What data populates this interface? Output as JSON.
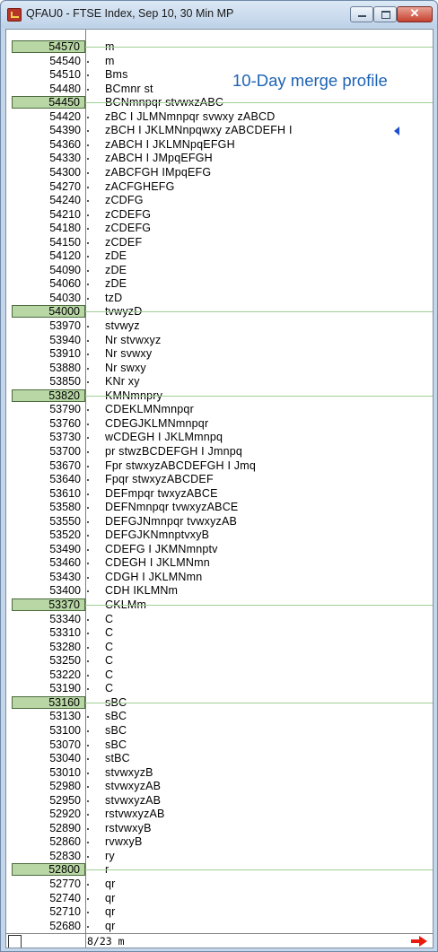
{
  "window": {
    "title": "QFAU0 - FTSE Index, Sep 10, 30 Min MP",
    "controls": {
      "minimize": "",
      "maximize": "",
      "close": "✕"
    }
  },
  "note": "10-Day merge profile",
  "rows": [
    {
      "price": "54570",
      "tpo": "m",
      "hl": true
    },
    {
      "price": "54540",
      "tpo": "m"
    },
    {
      "price": "54510",
      "tpo": "Bms"
    },
    {
      "price": "54480",
      "tpo": "BCmnr st"
    },
    {
      "price": "54450",
      "tpo": "BCNmnpqr stvwxzABC",
      "hl": true
    },
    {
      "price": "54420",
      "tpo": "zBC I JLMNmnpqr svwxy zABCD"
    },
    {
      "price": "54390",
      "tpo": "zBCH I JKLMNnpqwxy zABCDEFH I"
    },
    {
      "price": "54360",
      "tpo": "zABCH I JKLMNpqEFGH"
    },
    {
      "price": "54330",
      "tpo": "zABCH I JMpqEFGH"
    },
    {
      "price": "54300",
      "tpo": "zABCFGH IMpqEFG"
    },
    {
      "price": "54270",
      "tpo": "zACFGHEFG"
    },
    {
      "price": "54240",
      "tpo": "zCDFG"
    },
    {
      "price": "54210",
      "tpo": "zCDEFG"
    },
    {
      "price": "54180",
      "tpo": "zCDEFG"
    },
    {
      "price": "54150",
      "tpo": "zCDEF"
    },
    {
      "price": "54120",
      "tpo": "zDE"
    },
    {
      "price": "54090",
      "tpo": "zDE"
    },
    {
      "price": "54060",
      "tpo": "zDE"
    },
    {
      "price": "54030",
      "tpo": "tzD"
    },
    {
      "price": "54000",
      "tpo": "tvwyzD",
      "hl": true
    },
    {
      "price": "53970",
      "tpo": "stvwyz"
    },
    {
      "price": "53940",
      "tpo": "Nr stvwxyz"
    },
    {
      "price": "53910",
      "tpo": "Nr svwxy"
    },
    {
      "price": "53880",
      "tpo": "Nr swxy"
    },
    {
      "price": "53850",
      "tpo": "KNr xy"
    },
    {
      "price": "53820",
      "tpo": "KMNmnpry",
      "hl": true
    },
    {
      "price": "53790",
      "tpo": "CDEKLMNmnpqr"
    },
    {
      "price": "53760",
      "tpo": "CDEGJKLMNmnpqr"
    },
    {
      "price": "53730",
      "tpo": "wCDEGH I JKLMmnpq"
    },
    {
      "price": "53700",
      "tpo": "pr stwzBCDEFGH I Jmnpq"
    },
    {
      "price": "53670",
      "tpo": "Fpr stwxyzABCDEFGH I Jmq"
    },
    {
      "price": "53640",
      "tpo": "Fpqr stwxyzABCDEF"
    },
    {
      "price": "53610",
      "tpo": "DEFmpqr twxyzABCE"
    },
    {
      "price": "53580",
      "tpo": "DEFNmnpqr tvwxyzABCE"
    },
    {
      "price": "53550",
      "tpo": "DEFGJNmnpqr tvwxyzAB"
    },
    {
      "price": "53520",
      "tpo": "DEFGJKNmnptvxyB"
    },
    {
      "price": "53490",
      "tpo": "CDEFG I JKMNmnptv"
    },
    {
      "price": "53460",
      "tpo": "CDEGH I JKLMNmn"
    },
    {
      "price": "53430",
      "tpo": "CDGH I JKLMNmn"
    },
    {
      "price": "53400",
      "tpo": "CDH IKLMNm"
    },
    {
      "price": "53370",
      "tpo": "CKLMm",
      "hl": true
    },
    {
      "price": "53340",
      "tpo": "C"
    },
    {
      "price": "53310",
      "tpo": "C"
    },
    {
      "price": "53280",
      "tpo": "C"
    },
    {
      "price": "53250",
      "tpo": "C"
    },
    {
      "price": "53220",
      "tpo": "C"
    },
    {
      "price": "53190",
      "tpo": "C"
    },
    {
      "price": "53160",
      "tpo": "sBC",
      "hl": true
    },
    {
      "price": "53130",
      "tpo": "sBC"
    },
    {
      "price": "53100",
      "tpo": "sBC"
    },
    {
      "price": "53070",
      "tpo": "sBC"
    },
    {
      "price": "53040",
      "tpo": "stBC"
    },
    {
      "price": "53010",
      "tpo": "stvwxyzB"
    },
    {
      "price": "52980",
      "tpo": "stvwxyzAB"
    },
    {
      "price": "52950",
      "tpo": "stvwxyzAB"
    },
    {
      "price": "52920",
      "tpo": "rstvwxyzAB"
    },
    {
      "price": "52890",
      "tpo": "rstvwxyB"
    },
    {
      "price": "52860",
      "tpo": "rvwxyB"
    },
    {
      "price": "52830",
      "tpo": "ry"
    },
    {
      "price": "52800",
      "tpo": "r",
      "hl": true
    },
    {
      "price": "52770",
      "tpo": "qr"
    },
    {
      "price": "52740",
      "tpo": "qr"
    },
    {
      "price": "52710",
      "tpo": "qr"
    },
    {
      "price": "52680",
      "tpo": "qr"
    }
  ],
  "status": {
    "text": "8/23 m",
    "arrow_icon": "right-arrow-icon"
  },
  "colors": {
    "highlight": "#b9d7a5",
    "grid_line": "#9fcf94",
    "note": "#1e64b4",
    "arrow": "#e81c0c",
    "marker": "#1f4fd0"
  }
}
